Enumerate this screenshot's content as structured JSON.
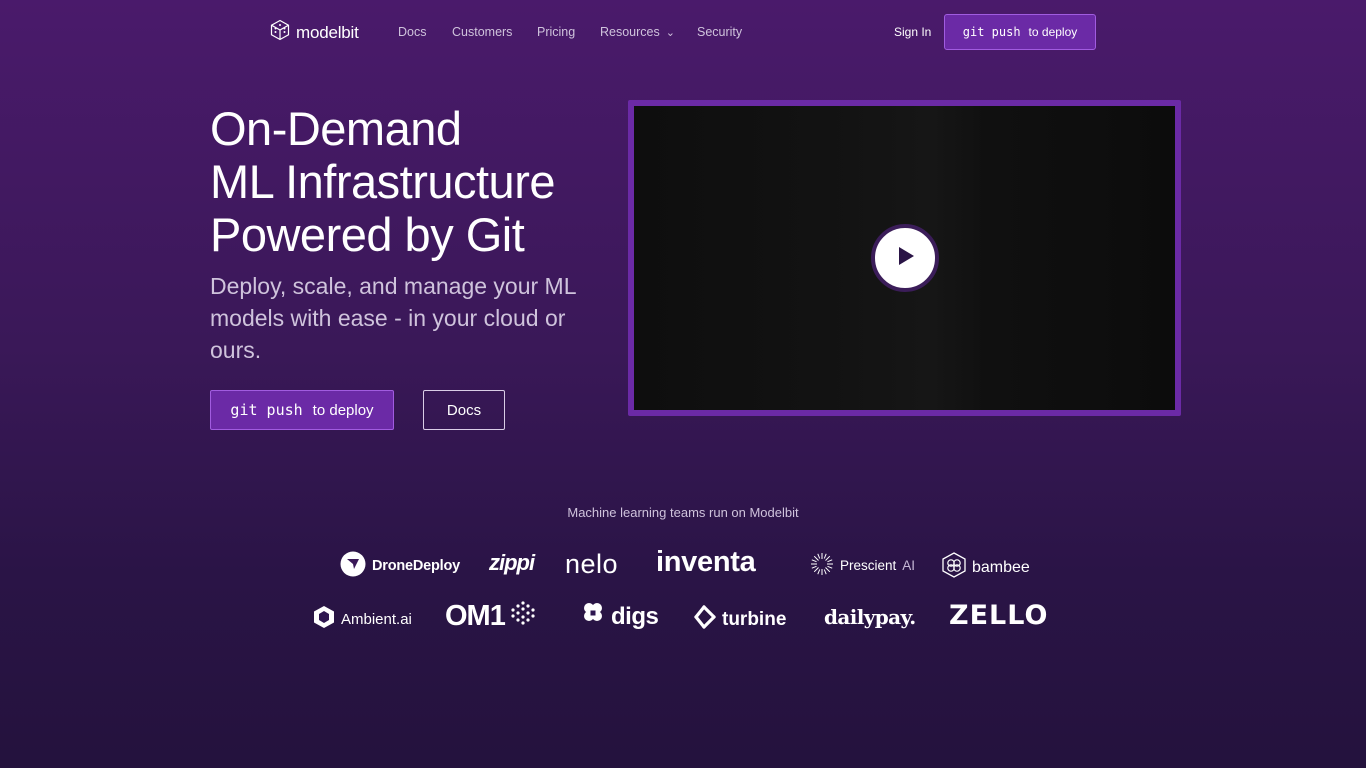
{
  "nav": {
    "logo_text": "modelbit",
    "links": [
      "Docs",
      "Customers",
      "Pricing",
      "Resources",
      "Security"
    ],
    "sign_in": "Sign In",
    "cta_code": "git push",
    "cta_text": "to deploy"
  },
  "hero": {
    "title_lines": [
      "On-Demand",
      "ML Infrastructure",
      "Powered by Git"
    ],
    "subtitle": "Deploy, scale, and manage your ML models with ease - in your cloud or ours.",
    "primary_code": "git push",
    "primary_text": "to deploy",
    "secondary_label": "Docs"
  },
  "video": {
    "accent_color": "#6b2aa6"
  },
  "customers": {
    "tagline": "Machine learning teams run on Modelbit",
    "row1": [
      "DroneDeploy",
      "zippi",
      "nelo",
      "inventa",
      "Prescient",
      "AI",
      "bambee"
    ],
    "row2": [
      "Ambient.ai",
      "OM1",
      "digs",
      "turbine",
      "dailypay.",
      "ZELLO"
    ]
  },
  "colors": {
    "background_top": "#4a1a6b",
    "background_bottom": "#24123d",
    "accent": "#6b2aa6",
    "accent_border": "#a15ce0",
    "muted_text": "#cfc3dc"
  }
}
